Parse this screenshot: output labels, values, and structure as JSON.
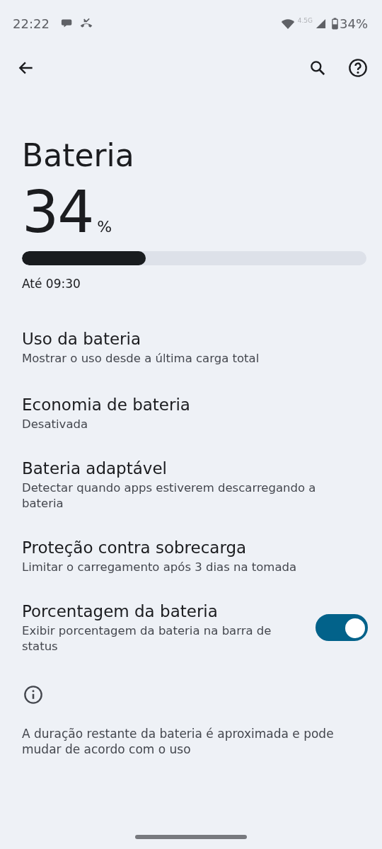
{
  "status_bar": {
    "time": "22:22",
    "network": "4.5G",
    "battery": "34%"
  },
  "page_title": "Bateria",
  "battery": {
    "percent": "34",
    "unit": "%",
    "level": 0.36,
    "estimate": "Até 09:30"
  },
  "settings": [
    {
      "kind": "plain",
      "title": "Uso da bateria",
      "subtitle": "Mostrar o uso desde a última carga total"
    },
    {
      "kind": "plain",
      "title": "Economia de bateria",
      "subtitle": "Desativada"
    },
    {
      "kind": "plain",
      "title": "Bateria adaptável",
      "subtitle": "Detectar quando apps estiverem descarregando a bateria"
    },
    {
      "kind": "plain",
      "title": "Proteção contra sobrecarga",
      "subtitle": "Limitar o carregamento após 3 dias na tomada"
    },
    {
      "kind": "switch",
      "title": "Porcentagem da bateria",
      "subtitle": "Exibir porcentagem da bateria na barra de status",
      "on": true
    }
  ],
  "footer_note": "A duração restante da bateria é aproximada e pode mudar de acordo com o uso"
}
